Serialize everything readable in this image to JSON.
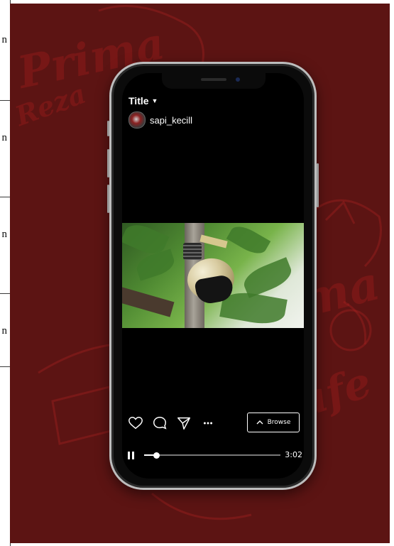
{
  "document_strip": {
    "visible_chars": [
      "n",
      "n",
      "n",
      "n"
    ]
  },
  "watermark": {
    "words": [
      "Prima",
      "Reza",
      "Prima",
      "Cafe"
    ]
  },
  "post": {
    "title": "Title",
    "username": "sapi_kecill",
    "browse_label": "Browse",
    "duration": "3:02",
    "progress": 0.09
  },
  "icons": {
    "title_caret": "caret-down-icon",
    "like": "heart-icon",
    "comment": "comment-bubble-icon",
    "share": "send-icon",
    "more": "more-icon",
    "browse": "chevron-up-icon",
    "play_state": "pause-icon"
  },
  "colors": {
    "background": "#5c1413",
    "watermark": "#aa1e1e",
    "screen": "#000000",
    "text": "#ffffff"
  }
}
